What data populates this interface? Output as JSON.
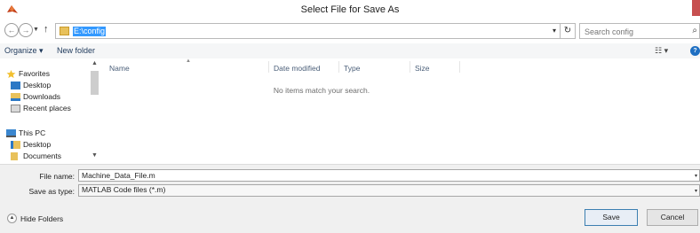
{
  "window": {
    "title": "Select File for Save As"
  },
  "address_bar": {
    "path": "E:\\config"
  },
  "search": {
    "placeholder": "Search config"
  },
  "toolbar": {
    "organize_label": "Organize ▾",
    "new_folder_label": "New folder"
  },
  "nav_pane": {
    "items": [
      {
        "label": "Favorites",
        "icon": "star-icon"
      },
      {
        "label": "Desktop",
        "icon": "desktop-icon"
      },
      {
        "label": "Downloads",
        "icon": "downloads-icon"
      },
      {
        "label": "Recent places",
        "icon": "recent-places-icon"
      },
      {
        "label": "This PC",
        "icon": "computer-icon"
      },
      {
        "label": "Desktop",
        "icon": "folder-icon"
      },
      {
        "label": "Documents",
        "icon": "documents-icon"
      }
    ]
  },
  "file_list": {
    "columns": [
      "Name",
      "Date modified",
      "Type",
      "Size"
    ],
    "empty_message": "No items match your search."
  },
  "save_form": {
    "file_name_label": "File name:",
    "file_name_value": "Machine_Data_File.m",
    "save_type_label": "Save as type:",
    "save_type_value": "MATLAB Code files (*.m)"
  },
  "footer": {
    "hide_folders_label": "Hide Folders",
    "save_label": "Save",
    "cancel_label": "Cancel"
  },
  "colors": {
    "accent": "#3399ff",
    "close": "#c75050",
    "matlab_red": "#c4411b",
    "folder": "#e8c15b"
  }
}
